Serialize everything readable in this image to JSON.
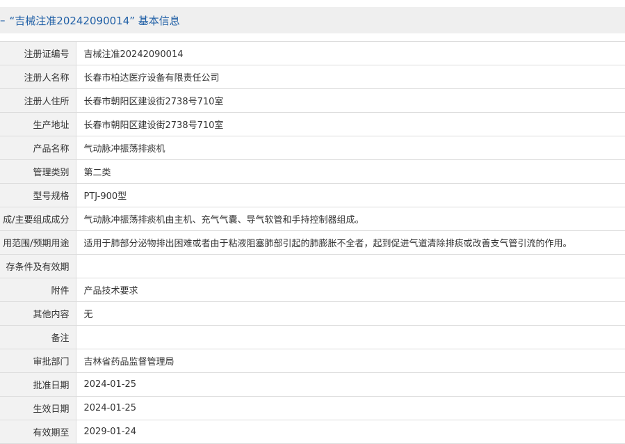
{
  "header": {
    "dash": "–",
    "title": "“吉械注准20242090014” 基本信息"
  },
  "rows": [
    {
      "label": "注册证编号",
      "value": "吉械注准20242090014"
    },
    {
      "label": "注册人名称",
      "value": "长春市柏达医疗设备有限责任公司"
    },
    {
      "label": "注册人住所",
      "value": "长春市朝阳区建设街2738号710室"
    },
    {
      "label": "生产地址",
      "value": "长春市朝阳区建设街2738号710室"
    },
    {
      "label": "产品名称",
      "value": "气动脉冲振荡排痰机"
    },
    {
      "label": "管理类别",
      "value": "第二类"
    },
    {
      "label": "型号规格",
      "value": "PTJ-900型"
    },
    {
      "label": "成/主要组成成分",
      "value": "气动脉冲振荡排痰机由主机、充气气囊、导气软管和手持控制器组成。"
    },
    {
      "label": "用范围/预期用途",
      "value": "适用于肺部分泌物排出困难或者由于粘液阻塞肺部引起的肺膨胀不全者，起到促进气道清除排痰或改善支气管引流的作用。"
    },
    {
      "label": "存条件及有效期",
      "value": ""
    },
    {
      "label": "附件",
      "value": "产品技术要求"
    },
    {
      "label": "其他内容",
      "value": "无"
    },
    {
      "label": "备注",
      "value": ""
    },
    {
      "label": "审批部门",
      "value": "吉林省药品监督管理局"
    },
    {
      "label": "批准日期",
      "value": "2024-01-25"
    },
    {
      "label": "生效日期",
      "value": "2024-01-25"
    },
    {
      "label": "有效期至",
      "value": "2029-01-24"
    }
  ]
}
